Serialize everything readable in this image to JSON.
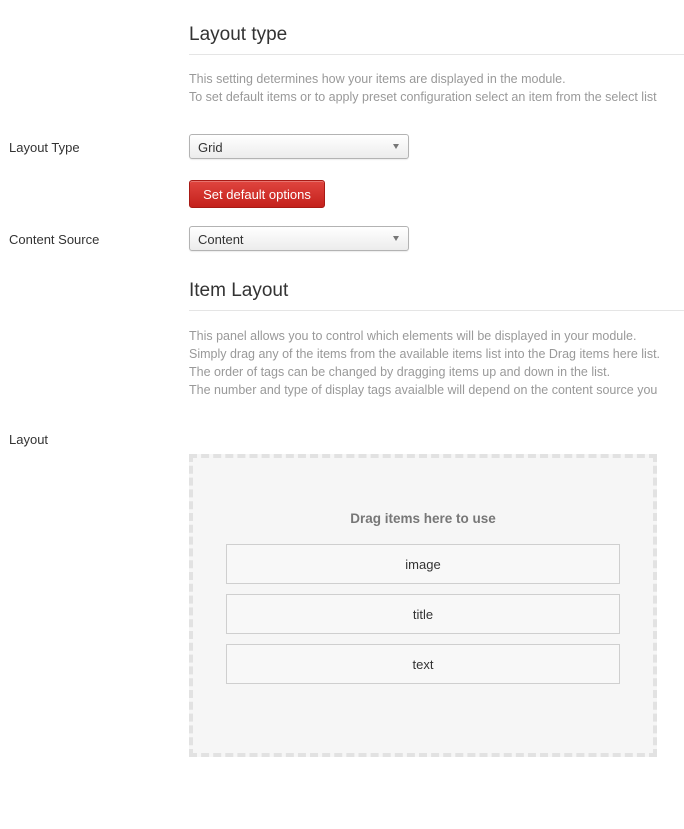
{
  "layout_type_section": {
    "title": "Layout type",
    "description_lines": [
      "This setting determines how your items are displayed in the module.",
      "To set default items or to apply preset configuration select an item from the select list"
    ]
  },
  "fields": {
    "layout_type": {
      "label": "Layout Type",
      "value": "Grid"
    },
    "set_default_button": "Set default options",
    "content_source": {
      "label": "Content Source",
      "value": "Content"
    }
  },
  "item_layout_section": {
    "title": "Item Layout",
    "description_lines": [
      "This panel allows you to control which elements will be displayed in your module.",
      "Simply drag any of the items from the available items list into the Drag items here list.",
      "The order of tags can be changed by dragging items up and down in the list.",
      "The number and type of display tags avaialble will depend on the content source you"
    ]
  },
  "layout": {
    "label": "Layout",
    "dropzone_title": "Drag items here to use",
    "items": [
      "image",
      "title",
      "text"
    ]
  }
}
